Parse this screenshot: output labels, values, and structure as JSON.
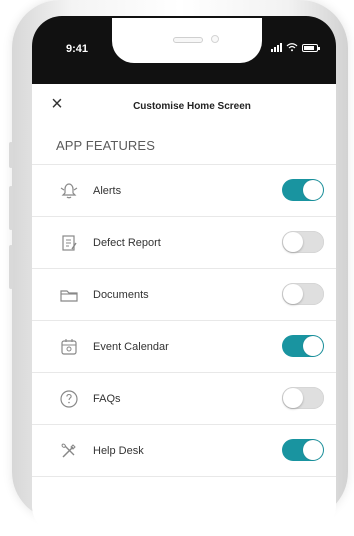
{
  "status": {
    "time": "9:41"
  },
  "header": {
    "title": "Customise Home Screen",
    "close_icon": "close-icon"
  },
  "section": {
    "label": "APP FEATURES"
  },
  "colors": {
    "toggle_on": "#1994a0",
    "toggle_off": "#dfdfdf"
  },
  "items": [
    {
      "label": "Alerts",
      "icon": "bell-icon",
      "enabled": true
    },
    {
      "label": "Defect Report",
      "icon": "clipboard-icon",
      "enabled": false
    },
    {
      "label": "Documents",
      "icon": "folder-icon",
      "enabled": false
    },
    {
      "label": "Event Calendar",
      "icon": "calendar-icon",
      "enabled": true
    },
    {
      "label": "FAQs",
      "icon": "help-circle-icon",
      "enabled": false
    },
    {
      "label": "Help Desk",
      "icon": "tools-icon",
      "enabled": true
    }
  ]
}
